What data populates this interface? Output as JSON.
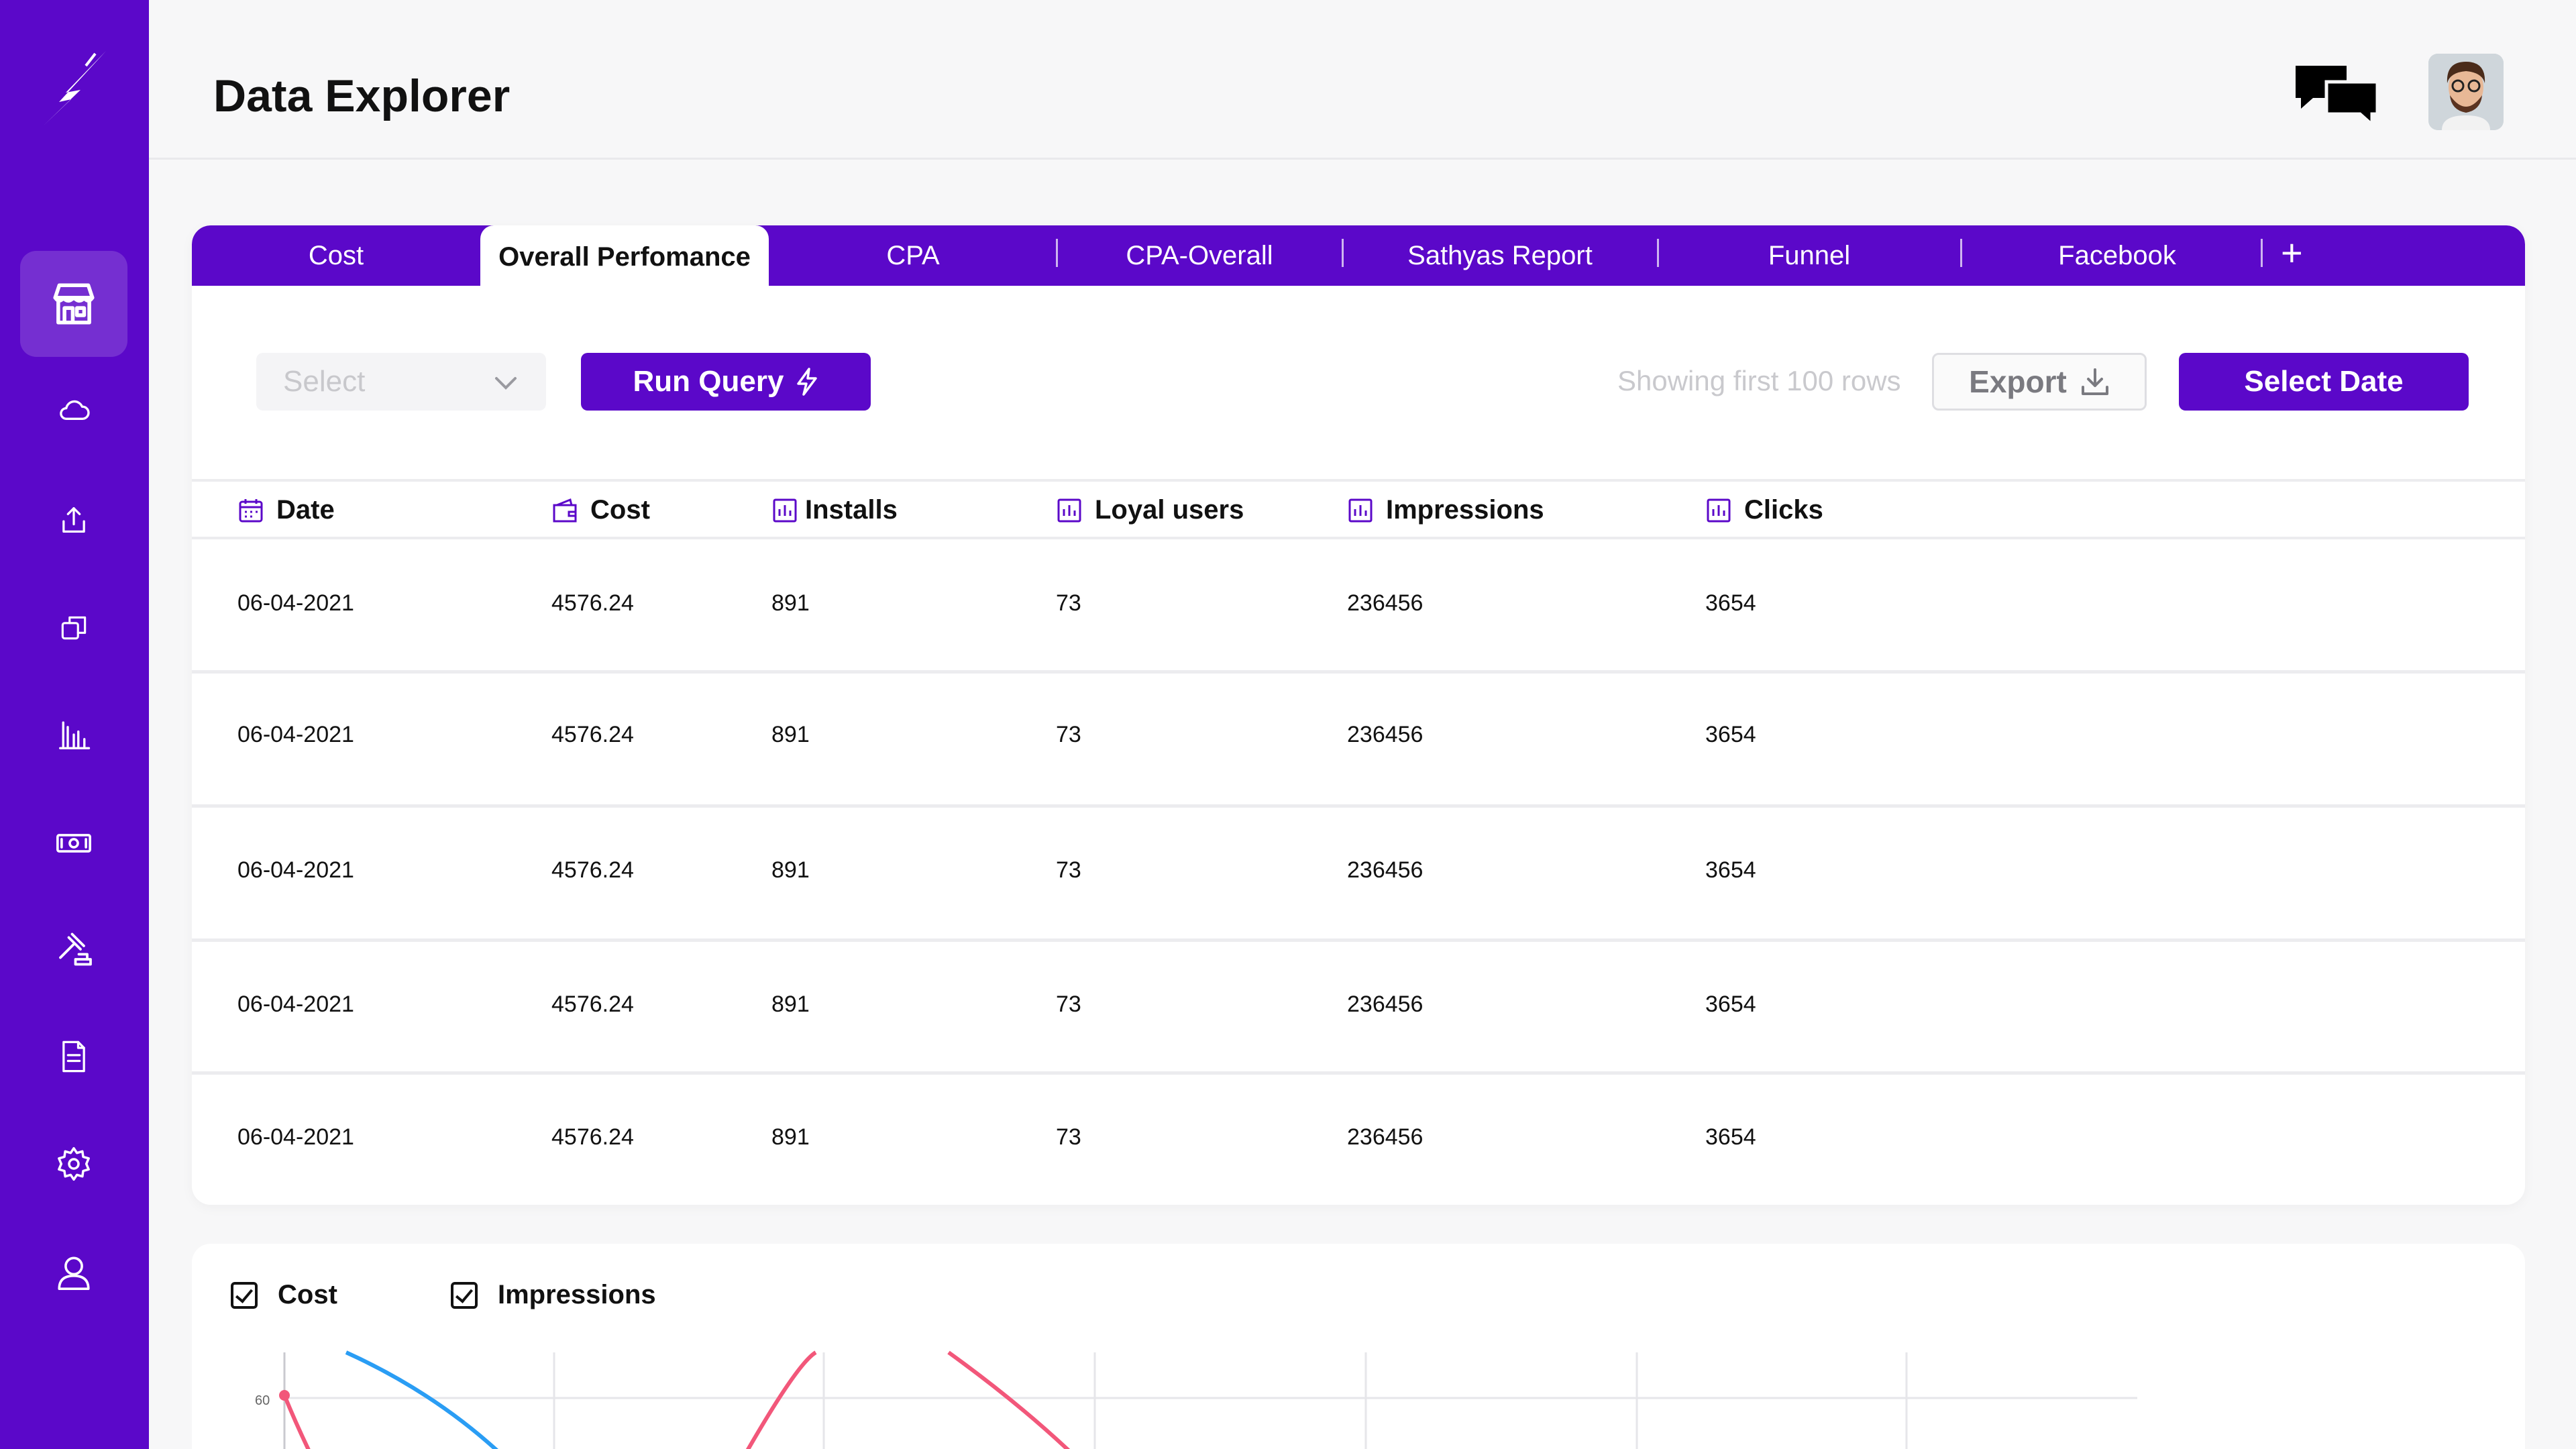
{
  "header": {
    "title": "Data Explorer"
  },
  "sidebar": {
    "items": [
      {
        "icon": "store-icon"
      },
      {
        "icon": "cloud-icon"
      },
      {
        "icon": "upload-icon"
      },
      {
        "icon": "copy-icon"
      },
      {
        "icon": "bar-chart-icon"
      },
      {
        "icon": "cash-icon"
      },
      {
        "icon": "auction-icon"
      },
      {
        "icon": "document-icon"
      },
      {
        "icon": "gear-icon"
      },
      {
        "icon": "user-icon"
      }
    ]
  },
  "tabs": [
    {
      "label": "Cost"
    },
    {
      "label": "Overall Perfomance"
    },
    {
      "label": "CPA"
    },
    {
      "label": "CPA-Overall"
    },
    {
      "label": "Sathyas Report"
    },
    {
      "label": "Funnel"
    },
    {
      "label": "Facebook"
    }
  ],
  "tab_add_label": "+",
  "toolbar": {
    "select_placeholder": "Select",
    "run_query_label": "Run Query",
    "showing_text": "Showing first 100 rows",
    "export_label": "Export",
    "select_date_label": "Select Date"
  },
  "table": {
    "columns": [
      "Date",
      "Cost",
      "Installs",
      "Loyal users",
      "Impressions",
      "Clicks"
    ],
    "rows": [
      [
        "06-04-2021",
        "4576.24",
        "891",
        "73",
        "236456",
        "3654"
      ],
      [
        "06-04-2021",
        "4576.24",
        "891",
        "73",
        "236456",
        "3654"
      ],
      [
        "06-04-2021",
        "4576.24",
        "891",
        "73",
        "236456",
        "3654"
      ],
      [
        "06-04-2021",
        "4576.24",
        "891",
        "73",
        "236456",
        "3654"
      ],
      [
        "06-04-2021",
        "4576.24",
        "891",
        "73",
        "236456",
        "3654"
      ]
    ]
  },
  "chart": {
    "legend": [
      "Cost",
      "Impressions"
    ],
    "y_tick": "60",
    "colors": {
      "cost": "#f2577a",
      "impressions": "#2a9df4"
    }
  },
  "colors": {
    "brand": "#5b08c9"
  }
}
